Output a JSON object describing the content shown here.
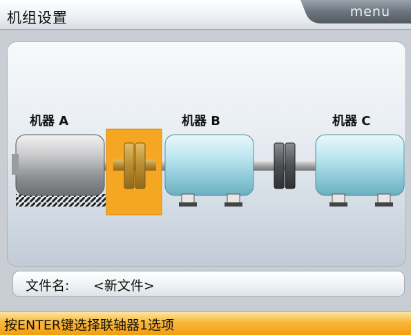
{
  "header": {
    "title": "机组设置",
    "menu_label": "menu"
  },
  "diagram": {
    "machines": [
      {
        "label": "机器 A",
        "style": "stationary"
      },
      {
        "label": "机器 B",
        "style": "movable"
      },
      {
        "label": "机器 C",
        "style": "movable"
      }
    ],
    "couplings": [
      {
        "index": 1,
        "selected": true
      },
      {
        "index": 2,
        "selected": false
      }
    ],
    "colors": {
      "selected_coupling": "#f5a623",
      "machine_blue": "#aee0ec",
      "machine_gray": "#a8aaad"
    }
  },
  "file": {
    "label": "文件名:",
    "value": "<新文件>"
  },
  "status": {
    "text": "按ENTER键选择联轴器1选项"
  }
}
